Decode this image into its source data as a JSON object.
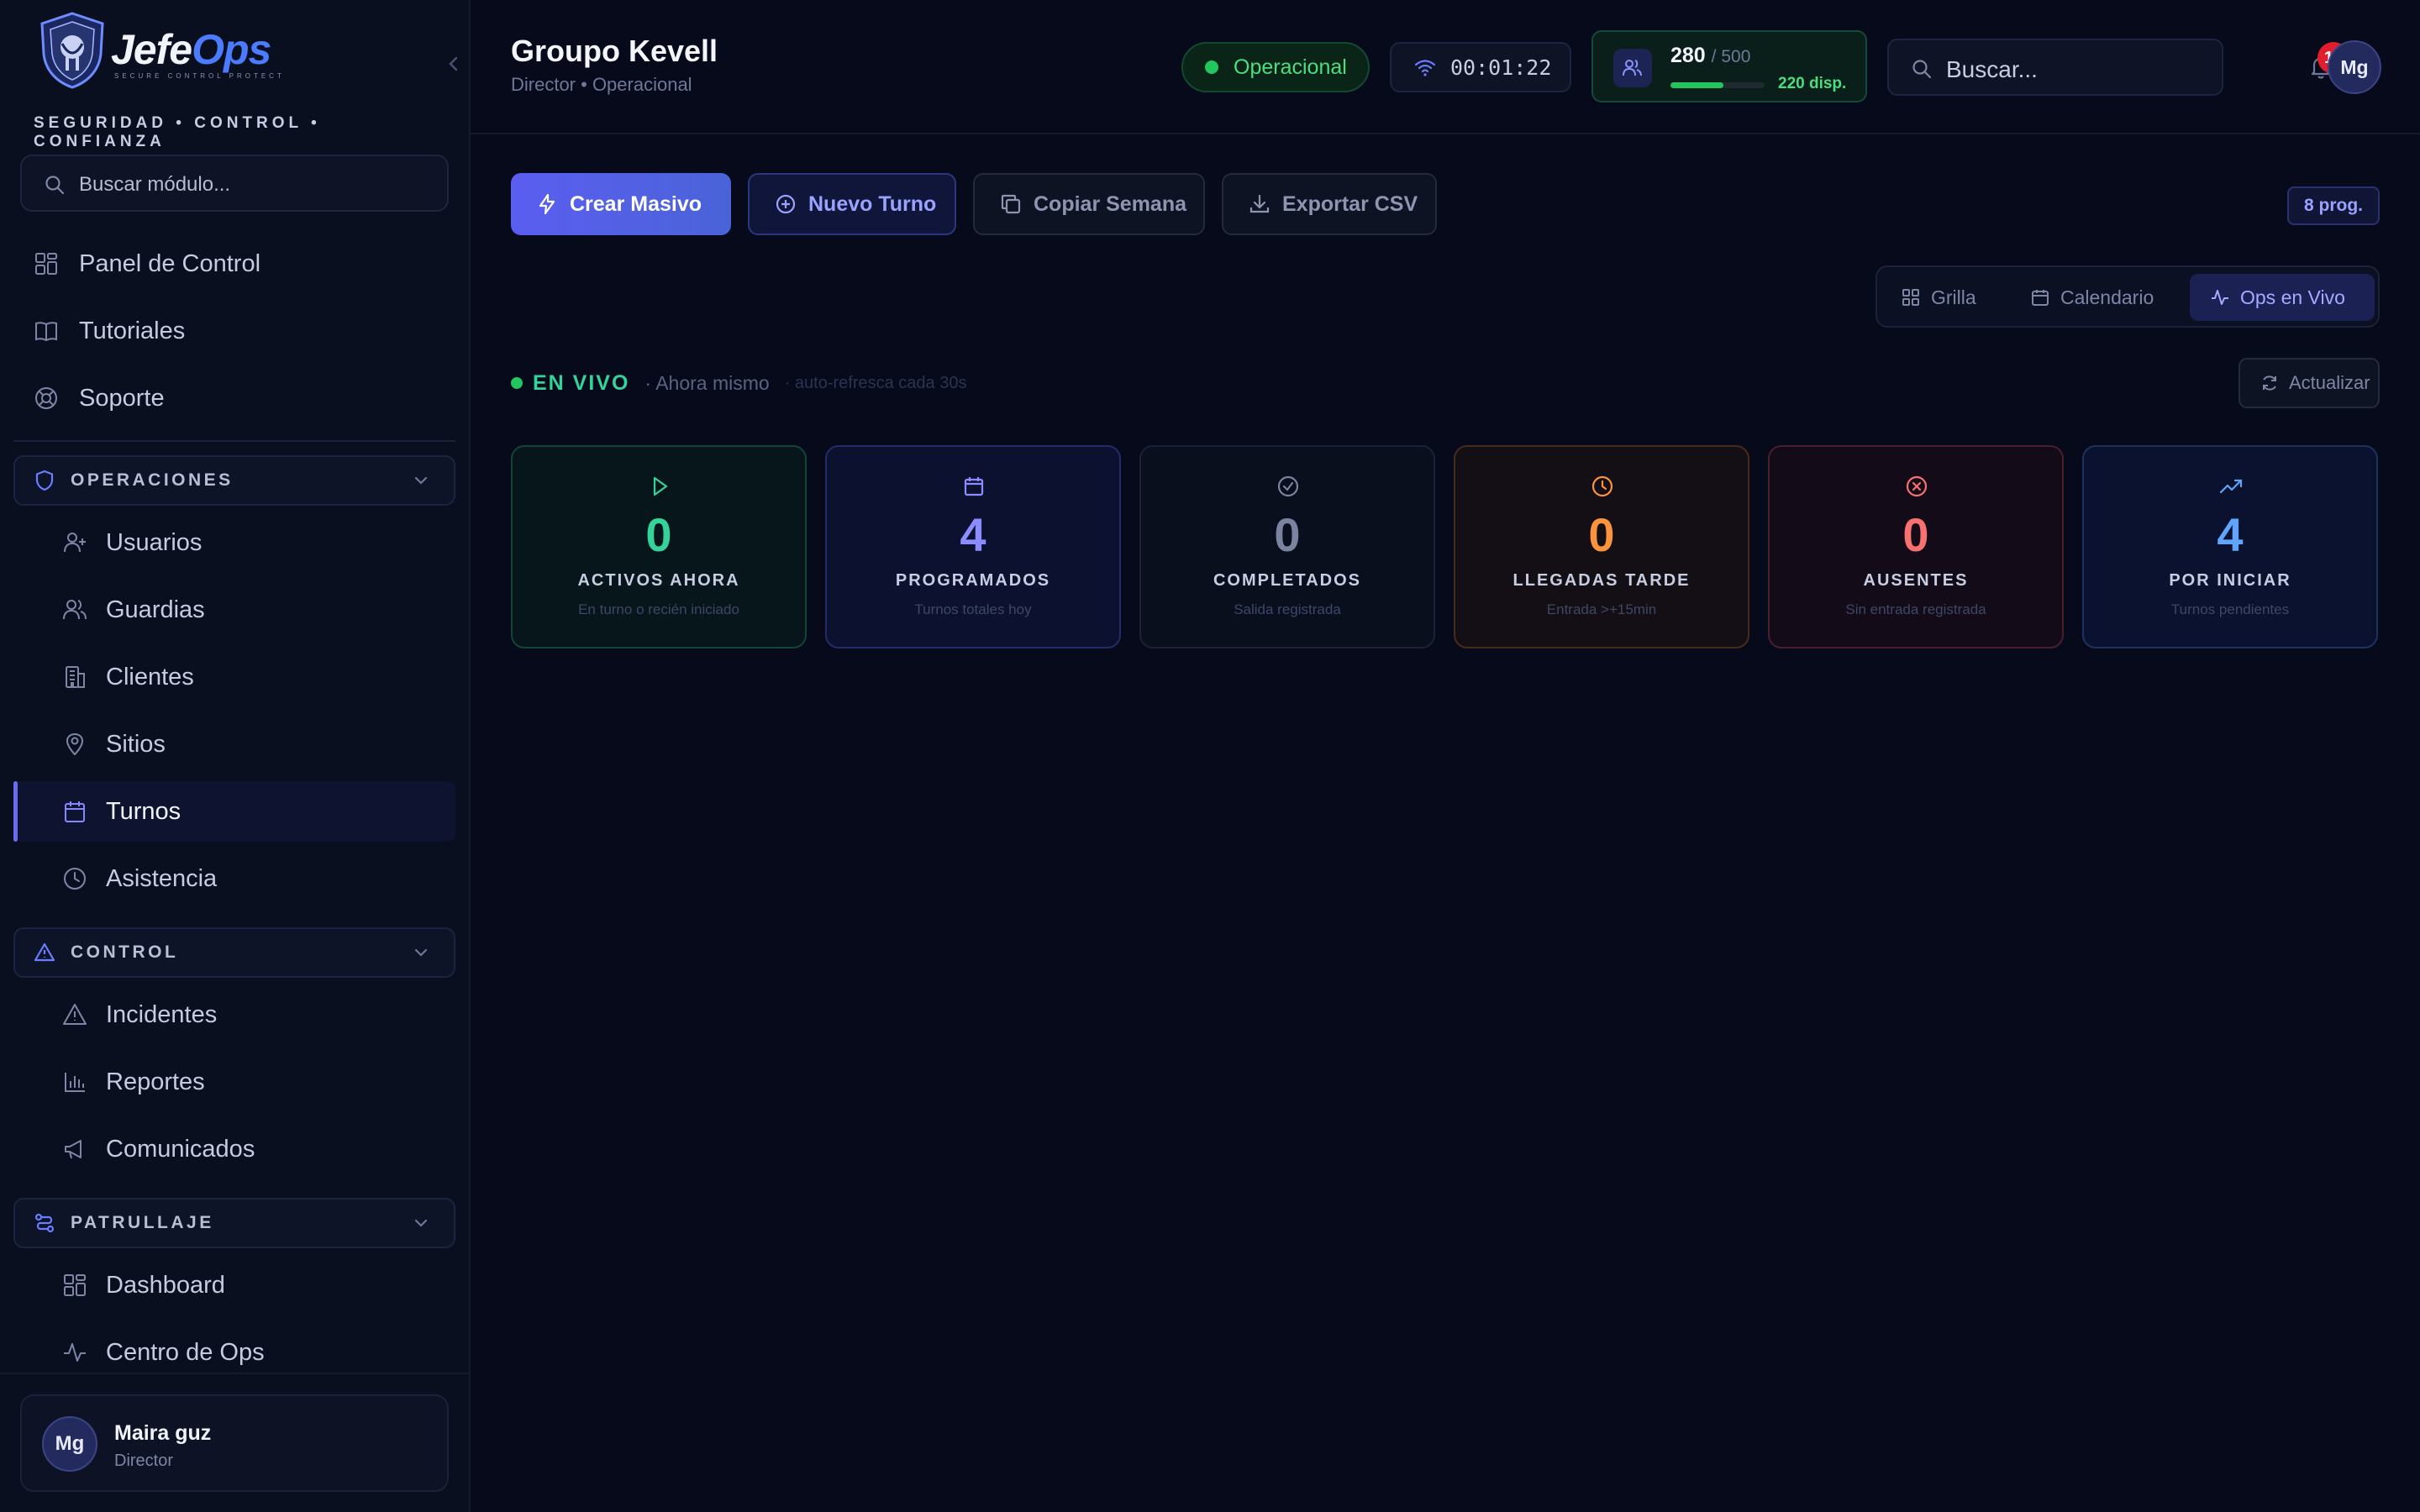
{
  "brand": {
    "name_part1": "Jefe",
    "name_part2": "Ops",
    "subtitle": "SECURE CONTROL PROTECT",
    "tagline": "SEGURIDAD • CONTROL • CONFIANZA"
  },
  "sidebar": {
    "search_placeholder": "Buscar módulo...",
    "top_items": [
      {
        "label": "Panel de Control",
        "icon": "grid-icon"
      },
      {
        "label": "Tutoriales",
        "icon": "book-icon"
      },
      {
        "label": "Soporte",
        "icon": "lifebuoy-icon"
      }
    ],
    "sections": [
      {
        "label": "OPERACIONES",
        "icon": "shield-icon",
        "items": [
          {
            "label": "Usuarios",
            "icon": "user-plus-icon"
          },
          {
            "label": "Guardias",
            "icon": "users-icon"
          },
          {
            "label": "Clientes",
            "icon": "building-icon"
          },
          {
            "label": "Sitios",
            "icon": "map-pin-icon"
          },
          {
            "label": "Turnos",
            "icon": "calendar-icon",
            "active": true
          },
          {
            "label": "Asistencia",
            "icon": "clock-icon"
          }
        ]
      },
      {
        "label": "CONTROL",
        "icon": "alert-triangle-icon",
        "items": [
          {
            "label": "Incidentes",
            "icon": "alert-triangle-icon"
          },
          {
            "label": "Reportes",
            "icon": "bar-chart-icon"
          },
          {
            "label": "Comunicados",
            "icon": "megaphone-icon"
          }
        ]
      },
      {
        "label": "PATRULLAJE",
        "icon": "route-icon",
        "items": [
          {
            "label": "Dashboard",
            "icon": "grid-icon"
          },
          {
            "label": "Centro de Ops",
            "icon": "activity-icon"
          }
        ]
      }
    ],
    "user": {
      "initials": "Mg",
      "name": "Maira guz",
      "role": "Director"
    }
  },
  "header": {
    "title": "Groupo Kevell",
    "subtitle": "Director • Operacional",
    "status": "Operacional",
    "timer": "00:01:22",
    "capacity": {
      "current": "280",
      "max": "/ 500",
      "available": "220 disp.",
      "fill_fraction": 0.56
    },
    "search_placeholder": "Buscar...",
    "notifications": "12",
    "avatar": "Mg"
  },
  "actions": {
    "create_bulk": "Crear Masivo",
    "new_shift": "Nuevo Turno",
    "copy_week": "Copiar Semana",
    "export_csv": "Exportar CSV",
    "programmed_badge": "8 prog."
  },
  "views": {
    "grid": "Grilla",
    "calendar": "Calendario",
    "live": "Ops en Vivo",
    "selected": "live"
  },
  "live": {
    "label": "EN VIVO",
    "time": "· Ahora mismo",
    "autorefresh": "· auto-refresca cada 30s",
    "refresh_button": "Actualizar"
  },
  "stats": [
    {
      "value": "0",
      "label": "ACTIVOS AHORA",
      "sub": "En turno o recién iniciado",
      "icon": "play-icon",
      "color": "#34d399"
    },
    {
      "value": "4",
      "label": "PROGRAMADOS",
      "sub": "Turnos totales hoy",
      "icon": "calendar-icon",
      "color": "#8b8cff"
    },
    {
      "value": "0",
      "label": "COMPLETADOS",
      "sub": "Salida registrada",
      "icon": "check-circle-icon",
      "color": "#7a839f"
    },
    {
      "value": "0",
      "label": "LLEGADAS TARDE",
      "sub": "Entrada >+15min",
      "icon": "clock-icon",
      "color": "#fb923c"
    },
    {
      "value": "0",
      "label": "AUSENTES",
      "sub": "Sin entrada registrada",
      "icon": "x-circle-icon",
      "color": "#f87171"
    },
    {
      "value": "4",
      "label": "POR INICIAR",
      "sub": "Turnos pendientes",
      "icon": "trending-up-icon",
      "color": "#60a5fa"
    }
  ]
}
